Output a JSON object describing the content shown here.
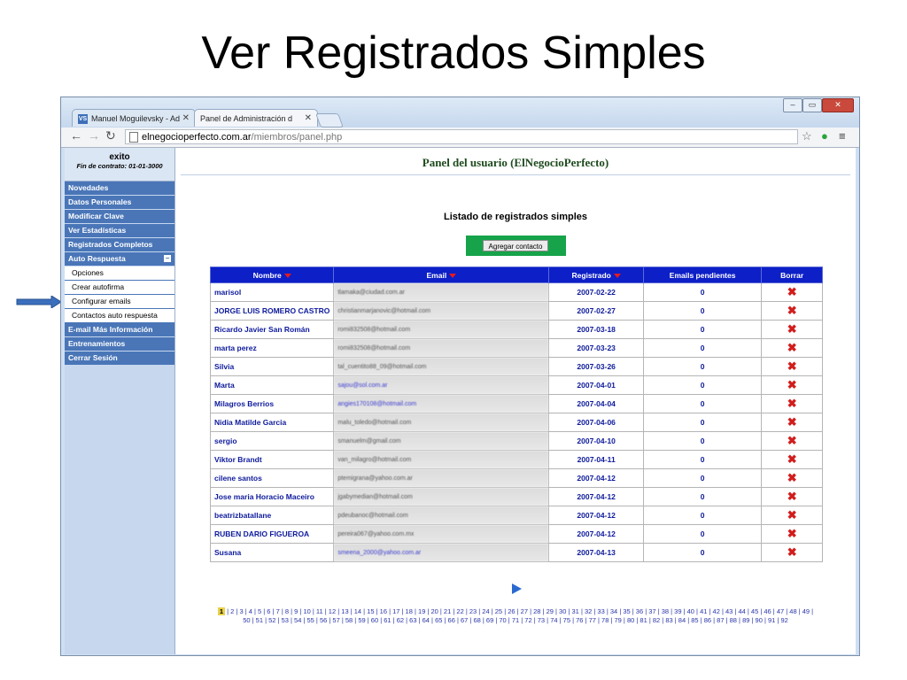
{
  "slide": {
    "title": "Ver Registrados Simples"
  },
  "browser": {
    "tabs": [
      {
        "favicon": "VS",
        "label": "Manuel Moguilevsky - Ad"
      },
      {
        "label": "Panel de Administración d"
      }
    ],
    "url_host": "elnegocioperfecto.com.ar",
    "url_path": "/miembros/panel.php"
  },
  "sidebar": {
    "user": "exito",
    "contract": "Fin de contrato: 01-01-3000",
    "items": [
      {
        "label": "Novedades"
      },
      {
        "label": "Datos Personales"
      },
      {
        "label": "Modificar Clave"
      },
      {
        "label": "Ver Estadísticas"
      },
      {
        "label": "Registrados Completos"
      }
    ],
    "auto": {
      "label": "Auto Respuesta",
      "subitems": [
        "Opciones",
        "Crear autofirma",
        "Configurar emails",
        "Contactos auto respuesta"
      ]
    },
    "items2": [
      {
        "label": "E-mail Más Información"
      },
      {
        "label": "Entrenamientos"
      },
      {
        "label": "Cerrar Sesión"
      }
    ]
  },
  "panel": {
    "title": "Panel del usuario (ElNegocioPerfecto)",
    "list_title": "Listado de registrados simples",
    "add_button": "Agregar contacto"
  },
  "table": {
    "headers": {
      "name": "Nombre",
      "email": "Email",
      "date": "Registrado",
      "pending": "Emails pendientes",
      "delete": "Borrar"
    },
    "rows": [
      {
        "name": "marisol",
        "email": "tlamaka@ciudad.com.ar",
        "date": "2007-02-22",
        "pending": "0"
      },
      {
        "name": "JORGE LUIS ROMERO CASTRO",
        "email": "christianmarjanovic@hotmail.com",
        "date": "2007-02-27",
        "pending": "0"
      },
      {
        "name": "Ricardo Javier San Román",
        "email": "romi832508@hotmail.com",
        "date": "2007-03-18",
        "pending": "0"
      },
      {
        "name": "marta perez",
        "email": "romi832508@hotmail.com",
        "date": "2007-03-23",
        "pending": "0"
      },
      {
        "name": "Silvia",
        "email": "tal_cuentito88_09@hotmail.com",
        "date": "2007-03-26",
        "pending": "0"
      },
      {
        "name": "Marta",
        "email": "sajou@sol.com.ar",
        "date": "2007-04-01",
        "pending": "0"
      },
      {
        "name": "Milagros Berrios",
        "email": "angies170108@hotmail.com",
        "date": "2007-04-04",
        "pending": "0"
      },
      {
        "name": "Nidia Matilde Garcia",
        "email": "malu_toledo@hotmail.com",
        "date": "2007-04-06",
        "pending": "0"
      },
      {
        "name": "sergio",
        "email": "smanuelm@gmail.com",
        "date": "2007-04-10",
        "pending": "0"
      },
      {
        "name": "Viktor Brandt",
        "email": "van_milagro@hotmail.com",
        "date": "2007-04-11",
        "pending": "0"
      },
      {
        "name": "cilene santos",
        "email": "ptemigrana@yahoo.com.ar",
        "date": "2007-04-12",
        "pending": "0"
      },
      {
        "name": "Jose maria Horacio Maceiro",
        "email": "jgabymedian@hotmail.com",
        "date": "2007-04-12",
        "pending": "0"
      },
      {
        "name": "beatrizbatallane",
        "email": "pdeubanoc@hotmail.com",
        "date": "2007-04-12",
        "pending": "0"
      },
      {
        "name": "RUBEN DARIO FIGUEROA",
        "email": "pereira067@yahoo.com.mx",
        "date": "2007-04-12",
        "pending": "0"
      },
      {
        "name": "Susana",
        "email": "smeena_2000@yahoo.com.ar",
        "date": "2007-04-13",
        "pending": "0"
      }
    ]
  },
  "pagination": {
    "current": "1",
    "line1": "| 2 | 3 | 4 | 5 | 6 | 7 | 8 | 9 | 10 | 11 | 12 | 13 | 14 | 15 | 16 | 17 | 18 | 19 | 20 | 21 | 22 | 23 | 24 | 25 | 26 | 27 | 28 | 29 | 30 | 31 | 32 | 33 | 34 | 35 | 36 | 37 | 38 | 39 | 40 | 41 | 42 | 43 | 44 | 45 | 46 | 47 | 48 | 49 |",
    "line2": "50 | 51 | 52 | 53 | 54 | 55 | 56 | 57 | 58 | 59 | 60 | 61 | 62 | 63 | 64 | 65 | 66 | 67 | 68 | 69 | 70 | 71 | 72 | 73 | 74 | 75 | 76 | 77 | 78 | 79 | 80 | 81 | 82 | 83 | 84 | 85 | 86 | 87 | 88 | 89 | 90 | 91 | 92"
  },
  "colors": {
    "header_blue": "#0d1fc7",
    "menu_blue": "#4a76b8",
    "add_green": "#16a34a",
    "delete_red": "#d21d1d"
  },
  "icons": {
    "delete": "x-delete-icon",
    "next": "next-arrow-icon",
    "pointer": "pointer-arrow-icon"
  }
}
